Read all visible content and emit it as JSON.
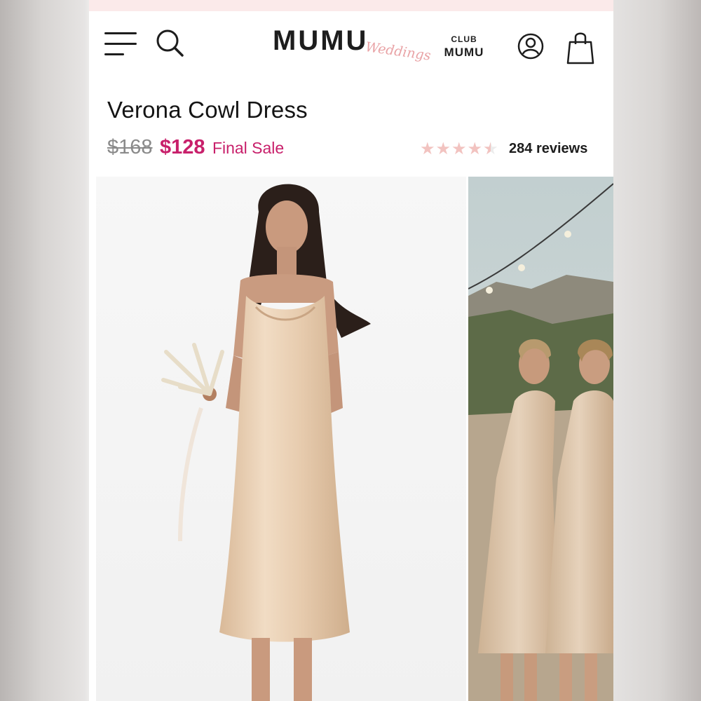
{
  "header": {
    "logo_main": "MUMU",
    "logo_script": "Weddings",
    "club_line1": "CLUB",
    "club_line2": "MUMU"
  },
  "product": {
    "title": "Verona Cowl Dress",
    "original_price": "$168",
    "sale_price": "$128",
    "sale_label": "Final Sale",
    "rating": 4.5,
    "rating_max": 5,
    "reviews_label": "284 reviews"
  },
  "icons": {
    "menu": "hamburger-menu-icon",
    "search": "search-icon",
    "account": "account-icon",
    "bag": "shopping-bag-icon",
    "star": "star-icon"
  },
  "colors": {
    "sale_pink": "#c8206b",
    "star_pink": "#f2c3c0",
    "logo_script_pink": "#e9a3a6",
    "banner_pink": "#fbeaea",
    "dress_champagne": "#e9cdb0"
  }
}
